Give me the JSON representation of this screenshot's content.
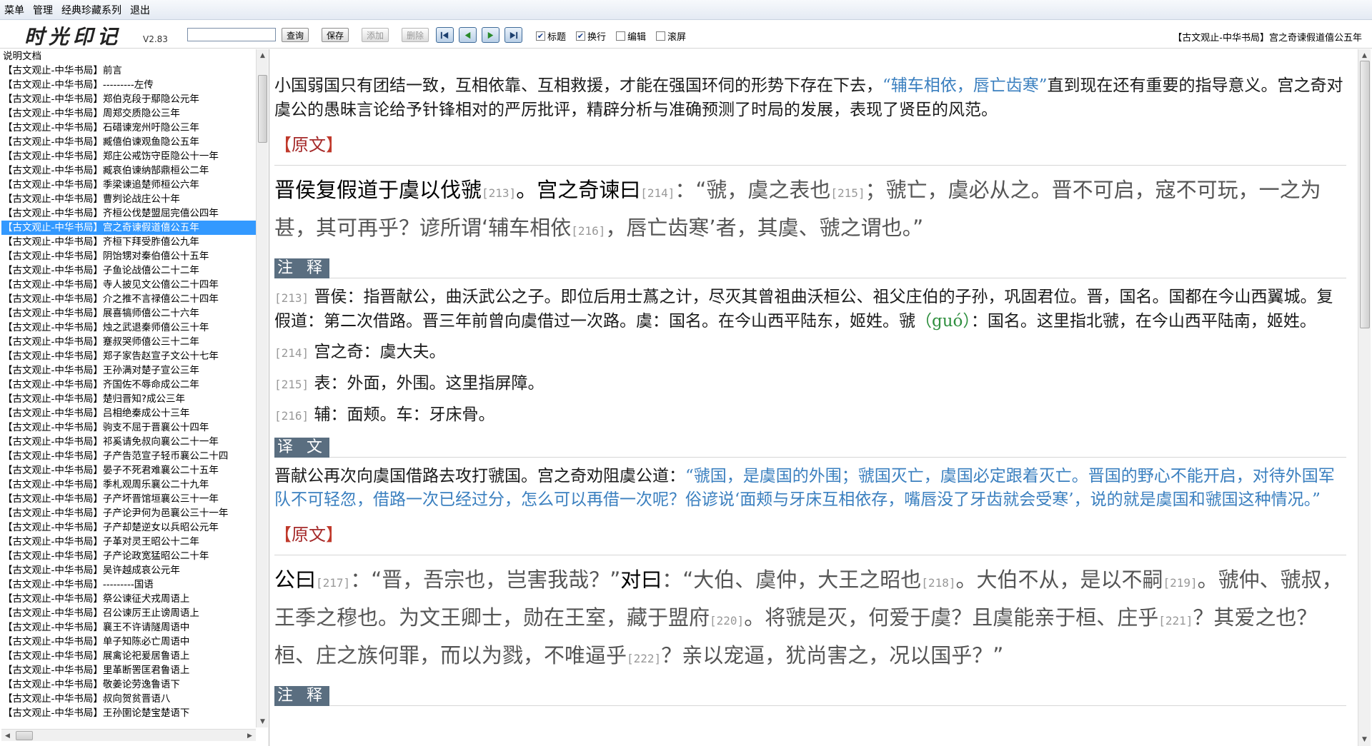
{
  "menu": [
    "菜单",
    "管理",
    "经典珍藏系列",
    "退出"
  ],
  "app": {
    "logo": "时光印记",
    "version": "V2.83"
  },
  "toolbar": {
    "search_value": "",
    "query": "查询",
    "save": "保存",
    "add": "添加",
    "delete": "删除",
    "checkboxes": [
      {
        "label": "标题",
        "checked": true
      },
      {
        "label": "换行",
        "checked": true
      },
      {
        "label": "编辑",
        "checked": false
      },
      {
        "label": "滚屏",
        "checked": false
      }
    ]
  },
  "doc_title": "【古文观止-中华书局】宫之奇谏假道僖公五年",
  "sidebar": {
    "selected_index": 12,
    "items": [
      "说明文档",
      "【古文观止-中华书局】前言",
      "【古文观止-中华书局】---------左传",
      "【古文观止-中华书局】郑伯克段于鄢隐公元年",
      "【古文观止-中华书局】周郑交质隐公三年",
      "【古文观止-中华书局】石碏谏宠州吁隐公三年",
      "【古文观止-中华书局】臧僖伯谏观鱼隐公五年",
      "【古文观止-中华书局】郑庄公戒饬守臣隐公十一年",
      "【古文观止-中华书局】臧哀伯谏纳郜鼎桓公二年",
      "【古文观止-中华书局】季梁谏追楚师桓公六年",
      "【古文观止-中华书局】曹刿论战庄公十年",
      "【古文观止-中华书局】齐桓公伐楚盟屈完僖公四年",
      "【古文观止-中华书局】宫之奇谏假道僖公五年",
      "【古文观止-中华书局】齐桓下拜受胙僖公九年",
      "【古文观止-中华书局】阴饴甥对秦伯僖公十五年",
      "【古文观止-中华书局】子鱼论战僖公二十二年",
      "【古文观止-中华书局】寺人披见文公僖公二十四年",
      "【古文观止-中华书局】介之推不言禄僖公二十四年",
      "【古文观止-中华书局】展喜犒师僖公二十六年",
      "【古文观止-中华书局】烛之武退秦师僖公三十年",
      "【古文观止-中华书局】蹇叔哭师僖公三十二年",
      "【古文观止-中华书局】郑子家告赵宣子文公十七年",
      "【古文观止-中华书局】王孙满对楚子宣公三年",
      "【古文观止-中华书局】齐国佐不辱命成公二年",
      "【古文观止-中华书局】楚归晋知?成公三年",
      "【古文观止-中华书局】吕相绝秦成公十三年",
      "【古文观止-中华书局】驹支不屈于晋襄公十四年",
      "【古文观止-中华书局】祁奚请免叔向襄公二十一年",
      "【古文观止-中华书局】子产告范宣子轻币襄公二十四",
      "【古文观止-中华书局】晏子不死君难襄公二十五年",
      "【古文观止-中华书局】季札观周乐襄公二十九年",
      "【古文观止-中华书局】子产坏晋馆垣襄公三十一年",
      "【古文观止-中华书局】子产论尹何为邑襄公三十一年",
      "【古文观止-中华书局】子产却楚逆女以兵昭公元年",
      "【古文观止-中华书局】子革对灵王昭公十二年",
      "【古文观止-中华书局】子产论政宽猛昭公二十年",
      "【古文观止-中华书局】吴许越成哀公元年",
      "【古文观止-中华书局】---------国语",
      "【古文观止-中华书局】祭公谏征犬戎周语上",
      "【古文观止-中华书局】召公谏厉王止谤周语上",
      "【古文观止-中华书局】襄王不许请隧周语中",
      "【古文观止-中华书局】单子知陈必亡周语中",
      "【古文观止-中华书局】展禽论祀爰居鲁语上",
      "【古文观止-中华书局】里革断罟匡君鲁语上",
      "【古文观止-中华书局】敬姜论劳逸鲁语下",
      "【古文观止-中华书局】叔向贺贫晋语八",
      "【古文观止-中华书局】王孙圉论楚宝楚语下"
    ]
  },
  "content": {
    "intro_pre": "小国弱国只有团结一致，互相依靠、互相救援，才能在强国环伺的形势下存在下去，",
    "intro_hl": "“辅车相依，唇亡齿寒”",
    "intro_post": "直到现在还有重要的指导意义。宫之奇对虞公的愚昧言论给予针锋相对的严厉批评，精辟分析与准确预测了时局的发展，表现了贤臣的风范。",
    "section_original": "原文",
    "section_notes": "注 释",
    "section_translation": "译 文",
    "orig1": {
      "s1": "晋侯复假道于虞以伐虢",
      "r1": "[213]",
      "s2": "。宫之奇谏曰",
      "r2": "[214]",
      "s3": "：“虢，虞之表也",
      "r3": "[215]",
      "s4": "；虢亡，虞必从之。晋不可启，寇不可玩，一之为甚，其可再乎？谚所谓‘辅车相依",
      "r4": "[216]",
      "s5": "，唇亡齿寒’者，其虞、虢之谓也。”"
    },
    "notes1": [
      {
        "ref": "[213]",
        "pre": "晋侯：指晋献公，曲沃武公之子。即位后用士蔿之计，尽灭其曾祖曲沃桓公、祖父庄伯的子孙，巩固君位。晋，国名。国都在今山西翼城。复假道：第二次借路。晋三年前曾向虞借过一次路。虞：国名。在今山西平陆东，姬姓。虢",
        "pinyin": "（guó）",
        "post": "：国名。这里指北虢，在今山西平陆南，姬姓。"
      },
      {
        "ref": "[214]",
        "pre": "宫之奇：虞大夫。",
        "pinyin": "",
        "post": ""
      },
      {
        "ref": "[215]",
        "pre": "表：外面，外围。这里指屏障。",
        "pinyin": "",
        "post": ""
      },
      {
        "ref": "[216]",
        "pre": "辅：面颊。车：牙床骨。",
        "pinyin": "",
        "post": ""
      }
    ],
    "trans_pre": "晋献公再次向虞国借路去攻打虢国。宫之奇劝阻虞公道：",
    "trans_hl": "“虢国，是虞国的外围；虢国灭亡，虞国必定跟着灭亡。晋国的野心不能开启，对待外国军队不可轻忽，借路一次已经过分，怎么可以再借一次呢？俗谚说‘面颊与牙床互相依存，嘴唇没了牙齿就会受寒’，说的就是虞国和虢国这种情况。”",
    "orig2": {
      "spk1": "公曰",
      "r1": "[217]",
      "s1": "：“晋，吾宗也，岂害我哉？”",
      "spk2": "对曰",
      "s2": "：“大伯、虞仲，大王之昭也",
      "r2": "[218]",
      "s3": "。大伯不从，是以不嗣",
      "r3": "[219]",
      "s4": "。虢仲、虢叔，王季之穆也。为文王卿士，勋在王室，藏于盟府",
      "r4": "[220]",
      "s5": "。将虢是灭，何爱于虞？且虞能亲于桓、庄乎",
      "r5": "[221]",
      "s6": "？其爱之也？桓、庄之族何罪，而以为戮，不唯逼乎",
      "r6": "[222]",
      "s7": "？亲以宠逼，犹尚害之，况以国乎？”"
    }
  }
}
